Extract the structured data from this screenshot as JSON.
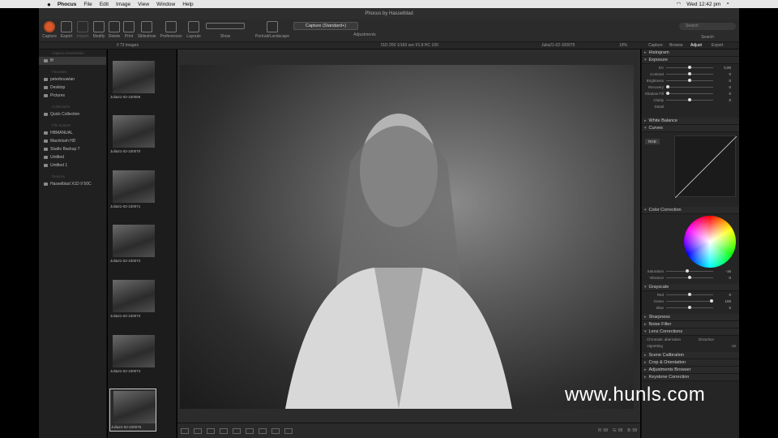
{
  "menubar": {
    "apple": "",
    "items": [
      "Phocus",
      "File",
      "Edit",
      "Image",
      "View",
      "Window",
      "Help"
    ],
    "clock": "Wed 12:42 pm"
  },
  "window": {
    "title": "Phocus by Hasselblad"
  },
  "toolbar": {
    "buttons": [
      "Capture",
      "Export",
      "Import",
      "Modify",
      "Delete",
      "Print",
      "Slideshow",
      "Preferences",
      "Layouts"
    ],
    "show_label": "Show",
    "portrait_label": "Portrait/Landscape",
    "preset": "Capture (Standard+)",
    "adjustments_label": "Adjustments",
    "search_placeholder": "Search",
    "search_label": "Search"
  },
  "tabrow": {
    "count": "/l 73 images",
    "exif": "ISO 200   1/160 sec   f/1.8   HC 100",
    "filename": "Julia21-02-100075",
    "zoom": "19%"
  },
  "left_panel": {
    "capture_destination_label": "Capture Destination",
    "capture_destination_item": "ffl",
    "favorites_label": "Favorites",
    "favorites": [
      "peterbouwlan",
      "Desktop",
      "Pictures"
    ],
    "collections_label": "Collections",
    "collections": [
      "Quick Collection"
    ],
    "file_system_label": "File System",
    "file_system": [
      "HBMANUAL",
      "Macintosh HD",
      "Studio Backup 7",
      "Untitled",
      "Untitled 1"
    ],
    "devices_label": "Devices",
    "devices": [
      "Hasselblad X1D II 50C"
    ]
  },
  "thumbnails": [
    {
      "name": "Julia21-02-100069"
    },
    {
      "name": "Julia21-02-100070"
    },
    {
      "name": "Julia21-02-100071"
    },
    {
      "name": "Julia21-02-100072"
    },
    {
      "name": "Julia21-02-100073"
    },
    {
      "name": "Julia21-02-100074"
    },
    {
      "name": "Julia21-02-100075"
    }
  ],
  "right_panel": {
    "tabs": [
      "Capture",
      "Browse",
      "Adjust",
      "Export"
    ],
    "active_tab": "Adjust",
    "histogram": "Histogram",
    "exposure": {
      "title": "Exposure",
      "sliders": [
        {
          "label": "EV",
          "value": "0,00",
          "level": 0.5
        },
        {
          "label": "Contrast",
          "value": "0",
          "level": 0.5
        },
        {
          "label": "Brightness",
          "value": "0",
          "level": 0.5
        },
        {
          "label": "Recovery",
          "value": "0",
          "level": 0.0
        },
        {
          "label": "Shadow Fill",
          "value": "0",
          "level": 0.0
        },
        {
          "label": "Clarity",
          "value": "0",
          "level": 0.5
        }
      ],
      "detail": "Detail"
    },
    "white_balance": "White Balance",
    "curves": {
      "title": "Curves",
      "channel": "RGB"
    },
    "color_correction": {
      "title": "Color Correction",
      "sliders": [
        {
          "label": "Saturation",
          "value": "-16",
          "level": 0.45
        },
        {
          "label": "Vibrance",
          "value": "0",
          "level": 0.5
        }
      ]
    },
    "grayscale": {
      "title": "Grayscale",
      "sliders": [
        {
          "label": "Red",
          "value": "0",
          "level": 0.5
        },
        {
          "label": "Green",
          "value": "100",
          "level": 1.0
        },
        {
          "label": "Blue",
          "value": "0",
          "level": 0.5
        }
      ]
    },
    "sections": [
      "Sharpness",
      "Noise Filter",
      "Lens Corrections"
    ],
    "lens": {
      "chromatic": "Chromatic aberration",
      "distortion": "Distortion",
      "vignetting": "Vignetting",
      "vignetting_value": "-16"
    },
    "sections2": [
      "Scene Calibration",
      "Crop & Orientation",
      "Adjustments Browser",
      "Keystone Correction"
    ]
  },
  "bottombar": {
    "r": "R: 58",
    "g": "G: 58",
    "b": "B: 58"
  },
  "watermark": "www.hunls.com"
}
